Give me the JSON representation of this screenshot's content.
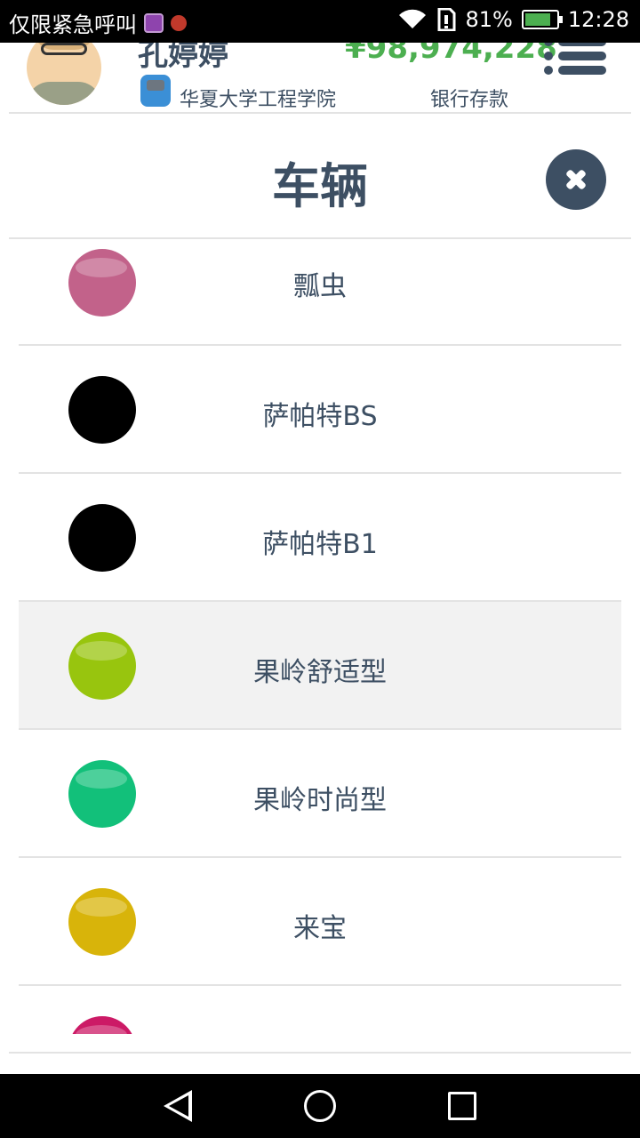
{
  "status_bar": {
    "emergency_text": "仅限紧急呼叫",
    "battery_level": "81%",
    "battery_fraction": 0.81,
    "time": "12:28",
    "icons": [
      "gallery-app-icon",
      "notification-app-icon",
      "wifi-icon",
      "sim-icon",
      "battery-icon"
    ]
  },
  "header": {
    "user_name": "孔婷婷",
    "balance": "¥98,974,228",
    "school": "华夏大学工程学院",
    "account_type": "银行存款",
    "balance_color": "#4caf50"
  },
  "dialog": {
    "title": "车辆"
  },
  "vehicles": [
    {
      "name": "瓢虫",
      "color": "#c2628a"
    },
    {
      "name": "萨帕特BS",
      "color": "#000000"
    },
    {
      "name": "萨帕特B1",
      "color": "#000000"
    },
    {
      "name": "果岭舒适型",
      "color": "#98c50e"
    },
    {
      "name": "果岭时尚型",
      "color": "#12c07a"
    },
    {
      "name": "来宝",
      "color": "#d8b40a"
    },
    {
      "name": "",
      "color": "#cc1a66"
    }
  ],
  "colors": {
    "text": "#3d4f63",
    "divider": "#e3e3e3",
    "selected_row": "#f2f2f2"
  }
}
